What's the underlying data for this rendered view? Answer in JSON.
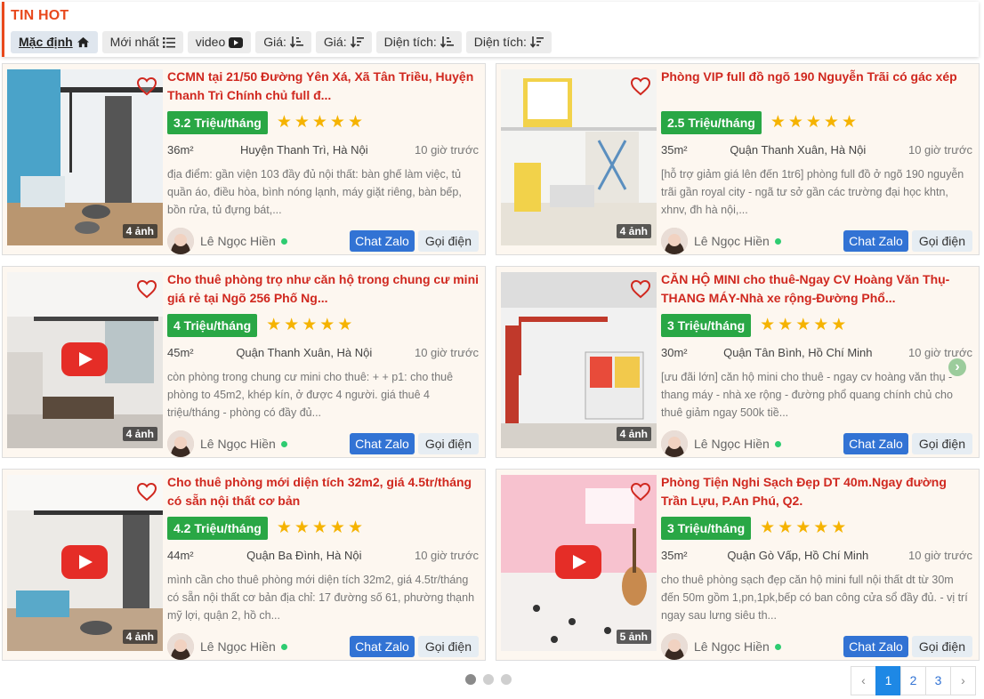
{
  "section": {
    "title": "TIN HOT"
  },
  "sort_buttons": [
    {
      "label": "Mặc định",
      "icon": "home-icon"
    },
    {
      "label": "Mới nhất",
      "icon": "list-icon"
    },
    {
      "label": "video",
      "icon": "youtube-icon"
    },
    {
      "label": "Giá:",
      "icon": "sort-asc-icon"
    },
    {
      "label": "Giá:",
      "icon": "sort-desc-icon"
    },
    {
      "label": "Diện tích:",
      "icon": "sort-asc-icon"
    },
    {
      "label": "Diện tích:",
      "icon": "sort-desc-icon"
    }
  ],
  "listings": [
    {
      "title": "CCMN tại 21/50 Đường Yên Xá, Xã Tân Triều, Huyện Thanh Trì Chính chủ full đ...",
      "price": "3.2 Triệu/tháng",
      "stars": "★★★★★",
      "area": "36m²",
      "location": "Huyện Thanh Trì, Hà Nội",
      "time": "10 giờ trước",
      "description": "địa điểm: gần viện 103 đầy đủ nội thất: bàn ghế làm việc, tủ quần áo, điều hòa, bình nóng lạnh, máy giặt riêng, bàn bếp, bồn rửa, tủ đựng bát,...",
      "image_count": "4 ảnh",
      "author": "Lê Ngọc Hiền",
      "zalo_label": "Chat Zalo",
      "call_label": "Gọi điện"
    },
    {
      "title": "Phòng VIP full đồ ngõ 190 Nguyễn Trãi có gác xép",
      "price": "2.5 Triệu/tháng",
      "stars": "★★★★★",
      "area": "35m²",
      "location": "Quận Thanh Xuân, Hà Nội",
      "time": "10 giờ trước",
      "description": "[hỗ trợ giảm giá lên đến 1tr6] phòng full đồ ở ngõ 190 nguyễn trãi gần royal city - ngã tư sở gần các trường đại học khtn, xhnv, đh hà nội,...",
      "image_count": "4 ảnh",
      "author": "Lê Ngọc Hiền",
      "zalo_label": "Chat Zalo",
      "call_label": "Gọi điện"
    },
    {
      "title": "Cho thuê phòng trọ như căn hộ trong chung cư mini giá rẻ tại Ngõ 256 Phố Ng...",
      "price": "4 Triệu/tháng",
      "stars": "★★★★★",
      "area": "45m²",
      "location": "Quận Thanh Xuân, Hà Nội",
      "time": "10 giờ trước",
      "description": "còn phòng trong chung cư mini cho thuê: + + p1: cho thuê phòng to 45m2, khép kín, ở được 4 người. giá thuê 4 triệu/tháng - phòng có đầy đủ...",
      "image_count": "4 ảnh",
      "author": "Lê Ngọc Hiền",
      "zalo_label": "Chat Zalo",
      "call_label": "Gọi điện"
    },
    {
      "title": "CĂN HỘ MINI cho thuê-Ngay CV Hoàng Văn Thụ-THANG MÁY-Nhà xe rộng-Đường Phổ...",
      "price": "3 Triệu/tháng",
      "stars": "★★★★★",
      "area": "30m²",
      "location": "Quận Tân Bình, Hồ Chí Minh",
      "time": "10 giờ trước",
      "description": "[ưu đãi lớn] căn hộ mini cho thuê - ngay cv hoàng văn thụ - thang máy - nhà xe rộng - đường phổ quang chính chủ cho thuê giảm ngay 500k tiề...",
      "image_count": "4 ảnh",
      "author": "Lê Ngọc Hiền",
      "zalo_label": "Chat Zalo",
      "call_label": "Gọi điện"
    },
    {
      "title": "Cho thuê phòng mới diện tích 32m2, giá 4.5tr/tháng có sẵn nội thất cơ bản",
      "price": "4.2 Triệu/tháng",
      "stars": "★★★★★",
      "area": "44m²",
      "location": "Quận Ba Đình, Hà Nội",
      "time": "10 giờ trước",
      "description": "mình cần cho thuê phòng mới diện tích 32m2, giá 4.5tr/tháng có sẵn nội thất cơ bản địa chỉ: 17 đường số 61, phường thạnh mỹ lợi, quận 2, hồ ch...",
      "image_count": "4 ảnh",
      "author": "Lê Ngọc Hiền",
      "zalo_label": "Chat Zalo",
      "call_label": "Gọi điện"
    },
    {
      "title": "Phòng Tiện Nghi Sạch Đẹp DT 40m.Ngay đường Trần Lựu, P.An Phú, Q2.",
      "price": "3 Triệu/tháng",
      "stars": "★★★★★",
      "area": "35m²",
      "location": "Quận Gò Vấp, Hồ Chí Minh",
      "time": "10 giờ trước",
      "description": "cho thuê phòng sạch đẹp căn hộ mini full nội thất dt từ 30m đến 50m gồm 1,pn,1pk,bếp có ban công cửa sổ đầy đủ. - vị trí ngay sau lưng siêu th...",
      "image_count": "5 ảnh",
      "author": "Lê Ngọc Hiền",
      "zalo_label": "Chat Zalo",
      "call_label": "Gọi điện"
    }
  ],
  "pagination": {
    "prev": "‹",
    "pages": [
      "1",
      "2",
      "3"
    ],
    "next": "›",
    "current": "1"
  },
  "carousel": {
    "next": "›"
  }
}
